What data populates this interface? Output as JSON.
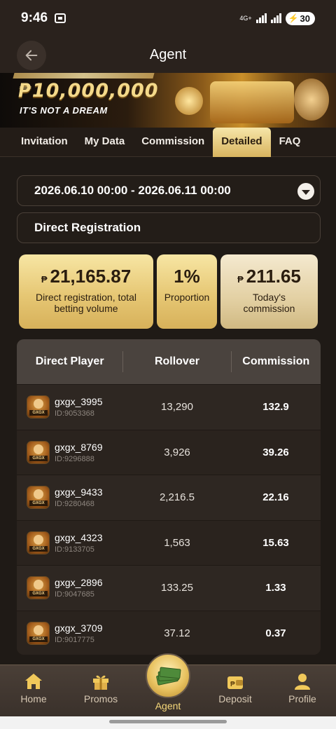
{
  "status_bar": {
    "time": "9:46",
    "network": "4G+",
    "battery": "30"
  },
  "header": {
    "title": "Agent"
  },
  "banner": {
    "amount": "₱10,000,000",
    "tagline": "IT'S NOT A DREAM"
  },
  "tabs": [
    {
      "label": "Invitation",
      "active": false
    },
    {
      "label": "My Data",
      "active": false
    },
    {
      "label": "Commission",
      "active": false
    },
    {
      "label": "Detailed",
      "active": true
    },
    {
      "label": "FAQ",
      "active": false
    }
  ],
  "date_range": "2026.06.10 00:00 - 2026.06.11 00:00",
  "filter_type": "Direct Registration",
  "summary": {
    "currency_symbol": "₱",
    "betting_volume": "21,165.87",
    "betting_volume_label": "Direct registration, total betting volume",
    "proportion": "1%",
    "proportion_label": "Proportion",
    "today_commission": "211.65",
    "today_commission_label": "Today's commission"
  },
  "table": {
    "headers": [
      "Direct Player",
      "Rollover",
      "Commission"
    ],
    "avatar_tag": "GXGX",
    "rows": [
      {
        "name": "gxgx_3995",
        "id": "ID:9053368",
        "rollover": "13,290",
        "commission": "132.9"
      },
      {
        "name": "gxgx_8769",
        "id": "ID:9296888",
        "rollover": "3,926",
        "commission": "39.26"
      },
      {
        "name": "gxgx_9433",
        "id": "ID:9280468",
        "rollover": "2,216.5",
        "commission": "22.16"
      },
      {
        "name": "gxgx_4323",
        "id": "ID:9133705",
        "rollover": "1,563",
        "commission": "15.63"
      },
      {
        "name": "gxgx_2896",
        "id": "ID:9047685",
        "rollover": "133.25",
        "commission": "1.33"
      },
      {
        "name": "gxgx_3709",
        "id": "ID:9017775",
        "rollover": "37.12",
        "commission": "0.37"
      }
    ]
  },
  "bottom_nav": [
    {
      "label": "Home",
      "icon": "home-icon"
    },
    {
      "label": "Promos",
      "icon": "gift-icon"
    },
    {
      "label": "Agent",
      "icon": "cash-stack-icon",
      "active": true
    },
    {
      "label": "Deposit",
      "icon": "wallet-icon"
    },
    {
      "label": "Profile",
      "icon": "person-icon"
    }
  ],
  "colors": {
    "background": "#1f1a16",
    "gold_accent": "#e6c774",
    "active_nav_label": "#f7d97a"
  }
}
